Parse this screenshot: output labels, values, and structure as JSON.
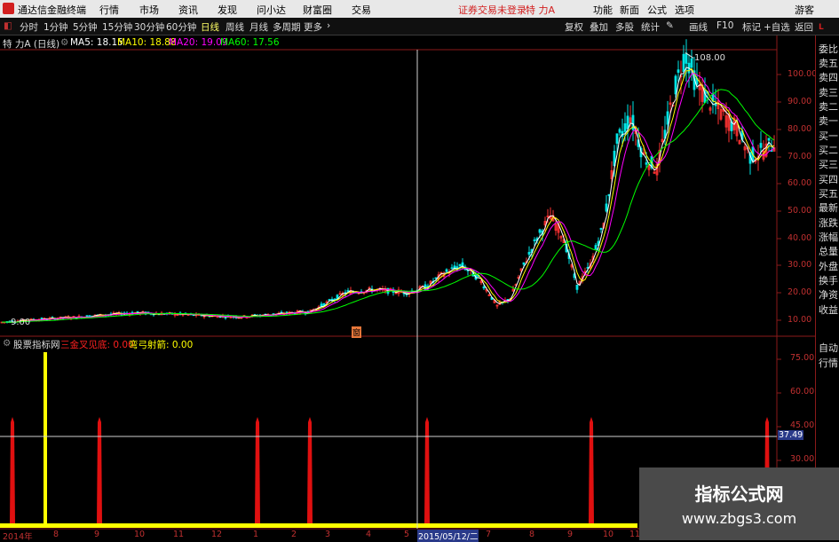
{
  "titlebar": {
    "app_name": "通达信金融终端",
    "menu": [
      "行情",
      "市场",
      "资讯",
      "发现",
      "问小达",
      "财富圈",
      "交易"
    ],
    "status": "证券交易未登录",
    "stock": "特 力A",
    "right_menu": [
      "功能",
      "新面",
      "公式",
      "选项"
    ],
    "user": "游客"
  },
  "periods": {
    "items": [
      "分时",
      "1分钟",
      "5分钟",
      "15分钟",
      "30分钟",
      "60分钟",
      "日线",
      "周线",
      "月线",
      "多周期",
      "更多"
    ],
    "tools": [
      "复权",
      "叠加",
      "多股",
      "统计",
      "画线",
      "F10",
      "标记",
      "+自选",
      "返回"
    ]
  },
  "info": {
    "name": "特 力A (日线)",
    "ma5": "MA5: 18.15",
    "ma10": "MA10: 18.88",
    "ma20": "MA20: 19.09",
    "ma60": "MA60: 17.56",
    "peak_label": "108.00",
    "low_label": "9.00",
    "marker": "窗"
  },
  "indicator": {
    "name": "股票指标网",
    "line1": "三金叉见底: 0.00",
    "line2": "弯弓射箭: 0.00",
    "crosshair_value": "37.49"
  },
  "right_panel": [
    "委比",
    "卖五",
    "卖四",
    "卖三",
    "卖二",
    "卖一",
    "买一",
    "买二",
    "买三",
    "买四",
    "买五",
    "最新",
    "涨跌",
    "涨幅",
    "总量",
    "外盘",
    "换手",
    "净资",
    "收益",
    "自动",
    "行情"
  ],
  "price_axis": [
    "100.00",
    "90.00",
    "80.00",
    "70.00",
    "60.00",
    "50.00",
    "40.00",
    "30.00",
    "20.00",
    "10.00"
  ],
  "ind_axis": [
    "75.00",
    "60.00",
    "45.00",
    "30.00"
  ],
  "x_axis": [
    "2014年",
    "8",
    "9",
    "10",
    "11",
    "12",
    "1",
    "2",
    "3",
    "4",
    "5",
    "2015/05/12/二",
    "7",
    "8",
    "9",
    "10",
    "11"
  ],
  "watermark": {
    "line1": "指标公式网",
    "line2": "www.zbgs3.com"
  },
  "colors": {
    "ma5": "#ffffff",
    "ma10": "#ffff00",
    "ma20": "#ff00ff",
    "ma60": "#00ff00",
    "accent": "#c03030"
  }
}
